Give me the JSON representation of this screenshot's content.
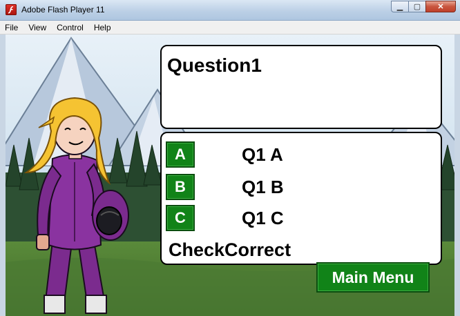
{
  "window": {
    "title": "Adobe Flash Player 11",
    "minimize_glyph": "▁",
    "maximize_glyph": "▢",
    "close_glyph": "✕"
  },
  "menu": {
    "items": [
      "File",
      "View",
      "Control",
      "Help"
    ]
  },
  "game": {
    "question": "Question1",
    "choices": [
      {
        "letter": "A",
        "text": "Q1 A"
      },
      {
        "letter": "B",
        "text": "Q1 B"
      },
      {
        "letter": "C",
        "text": "Q1 C"
      }
    ],
    "check_label": "CheckCorrect",
    "main_menu_label": "Main Menu"
  },
  "colors": {
    "button_green": "#118318",
    "panel_bg": "#ffffff",
    "suit_purple": "#7b2b8e",
    "hair_yellow": "#f5c332"
  },
  "icons": {
    "app": "flash-player-icon"
  }
}
